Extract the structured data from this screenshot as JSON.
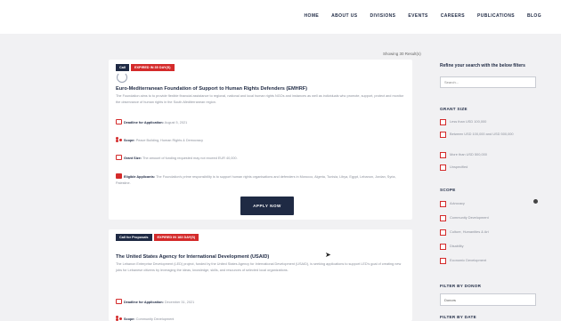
{
  "nav": {
    "items": [
      "HOME",
      "ABOUT US",
      "DIVISIONS",
      "EVENTS",
      "CAREERS",
      "PUBLICATIONS",
      "BLOG"
    ]
  },
  "results": {
    "showing": "Showing 30 Result(s)"
  },
  "card1": {
    "badge_type": "Call",
    "badge_expired": "EXPIRED IN 35 DAY(S)",
    "title": "Euro-Mediterranean Foundation of Support to Human Rights Defenders (EMHRF)",
    "description": "The Foundation aims to to provide flexible financial assistance to regional, national and local human rights NGOs and instances as well as individuals who promote, support, protect and monitor the observance of human rights in the South-Mediterranean region.",
    "deadline_label": "Deadline for Application:",
    "deadline_value": "August 5, 2021",
    "scope_label": "Scope:",
    "scope_value": "Peace Building, Human Rights & Democracy",
    "grant_label": "Grant Size:",
    "grant_value": "The amount of funding requested may not exceed EUR 40,000.",
    "eligible_label": "Eligible Applicants:",
    "eligible_value": "The Foundation's prime responsibility is to support human rights organisations and defenders in Morocco, Algeria, Tunisia, Libya, Egypt, Lebanon, Jordan, Syria, Palestine.",
    "apply_label": "APPLY NOW"
  },
  "card2": {
    "badge_type": "Call for Proposals",
    "badge_expired": "EXPIRED IN 183 DAY(S)",
    "title": "The United States Agency for International Development (USAID)",
    "description": "The Lebanon Enterprise Development (LED) project, funded by the United States Agency for International Development (USAID), is seeking applications to support LED's goal of creating new jobs for Lebanese citizens by leveraging the ideas, knowledge, skills, and resources of selected local organizations.",
    "deadline_label": "Deadline for Application:",
    "deadline_value": "December 31, 2021",
    "scope_label": "Scope:",
    "scope_value": "Community Development"
  },
  "sidebar": {
    "heading": "Refine your search with the below filters",
    "search_placeholder": "Search...",
    "grant_size_title": "GRANT SIZE",
    "grant_options": [
      "Less than USD 100,000",
      "Between USD 100,000 and USD 500,000",
      "More than USD 500,000",
      "Unspecified"
    ],
    "scope_title": "SCOPE",
    "scope_options": [
      "Advocacy",
      "Community Development",
      "Culture, Humanities & Art",
      "Disability",
      "Economic Development"
    ],
    "donor_title": "FILTER BY DONOR",
    "donor_value": "Donors",
    "date_title": "FILTER BY DATE"
  },
  "colors": {
    "navy": "#1f2a44",
    "red": "#d42a2a",
    "background": "#f1f1f3"
  }
}
